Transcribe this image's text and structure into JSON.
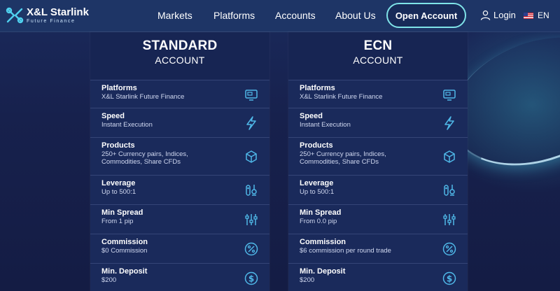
{
  "brand": {
    "title": "X&L Starlink",
    "subtitle": "Future Finance"
  },
  "nav": {
    "items": [
      "Markets",
      "Platforms",
      "Accounts",
      "About Us"
    ],
    "cta": "Open Account",
    "login": "Login",
    "lang": "EN"
  },
  "accent": "#4fb8e8",
  "accounts": [
    {
      "title": "STANDARD",
      "subtitle": "ACCOUNT",
      "rows": [
        {
          "label": "Platforms",
          "value": "X&L Starlink Future Finance",
          "icon": "monitor-icon"
        },
        {
          "label": "Speed",
          "value": "Instant Execution",
          "icon": "lightning-icon"
        },
        {
          "label": "Products",
          "value": "250+ Currency pairs, Indices,\nCommodities, Share CFDs",
          "icon": "cube-icon"
        },
        {
          "label": "Leverage",
          "value": "Up to 500:1",
          "icon": "pulley-icon"
        },
        {
          "label": "Min Spread",
          "value": "From 1 pip",
          "icon": "sliders-icon"
        },
        {
          "label": "Commission",
          "value": "$0 Commission",
          "icon": "percent-icon"
        },
        {
          "label": "Min. Deposit",
          "value": "$200",
          "icon": "dollar-icon"
        }
      ]
    },
    {
      "title": "ECN",
      "subtitle": "ACCOUNT",
      "rows": [
        {
          "label": "Platforms",
          "value": "X&L Starlink Future Finance",
          "icon": "monitor-icon"
        },
        {
          "label": "Speed",
          "value": "Instant Execution",
          "icon": "lightning-icon"
        },
        {
          "label": "Products",
          "value": "250+ Currency pairs, Indices,\nCommodities, Share CFDs",
          "icon": "cube-icon"
        },
        {
          "label": "Leverage",
          "value": "Up to 500:1",
          "icon": "pulley-icon"
        },
        {
          "label": "Min Spread",
          "value": "From 0.0 pip",
          "icon": "sliders-icon"
        },
        {
          "label": "Commission",
          "value": "$6 commission per round trade",
          "icon": "percent-icon"
        },
        {
          "label": "Min. Deposit",
          "value": "$200",
          "icon": "dollar-icon"
        }
      ]
    }
  ]
}
